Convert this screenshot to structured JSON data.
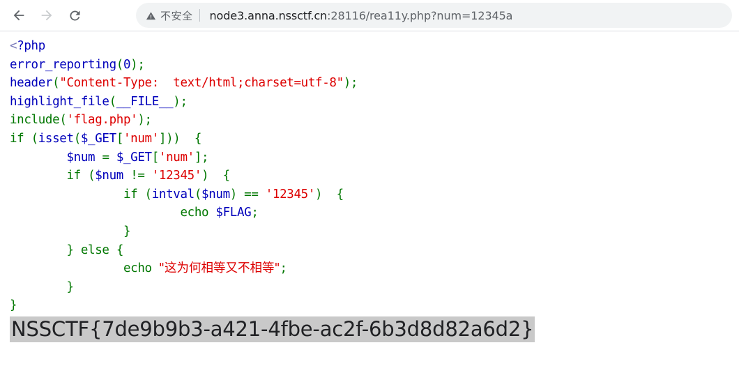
{
  "browser": {
    "back_button": "Back",
    "forward_button": "Forward",
    "reload_button": "Reload",
    "security_label": "不安全",
    "url_host": "node3.anna.nssctf.cn",
    "url_rest": ":28116/rea11y.php?num=12345a",
    "url_full": "node3.anna.nssctf.cn:28116/rea11y.php?num=12345a"
  },
  "colors": {
    "php_default": "#007700",
    "php_string": "#DD0000",
    "php_variable": "#0000BB",
    "php_tag": "#0000BB",
    "selection_highlight": "#c9c9c9",
    "omnibox_background": "#f1f3f4",
    "page_background": "#ffffff"
  },
  "source": {
    "language": "php",
    "lines": [
      "<?php",
      "error_reporting(0);",
      "header(\"Content-Type:  text/html;charset=utf-8\");",
      "highlight_file(__FILE__);",
      "include('flag.php');",
      "if (isset($_GET['num']))  {",
      "        $num = $_GET['num'];",
      "        if ($num != '12345')  {",
      "                if (intval($num) == '12345')  {",
      "                        echo $FLAG;",
      "                }",
      "        } else {",
      "                echo \"这为何相等又不相等\";",
      "        }",
      "}"
    ],
    "tokens": {
      "php_open_tag": "<?php",
      "fn_error_reporting": "error_reporting",
      "fn_header": "header",
      "fn_highlight_file": "highlight_file",
      "fn_intval": "intval",
      "kw_include": "include",
      "kw_if": "if",
      "kw_else": "else",
      "kw_echo": "echo",
      "kw_isset": "isset",
      "const_file": "__FILE__",
      "var_num": "$num",
      "var_get": "$_GET",
      "var_flag": "$FLAG",
      "str_content_type": "\"Content-Type:  text/html;charset=utf-8\"",
      "str_flag_php": "'flag.php'",
      "str_num_key": "'num'",
      "str_12345": "'12345'",
      "str_chinese_message": "\"这为何相等又不相等\"",
      "literal_zero": "0"
    }
  },
  "output": {
    "flag": "NSSCTF{7de9b9b3-a421-4fbe-ac2f-6b3d8d82a6d2}",
    "selected": true
  }
}
